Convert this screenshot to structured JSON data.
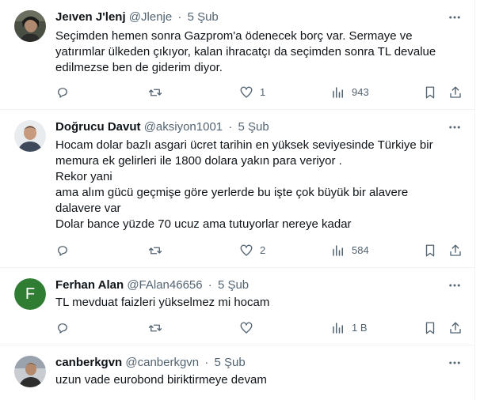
{
  "tweets": [
    {
      "name": "Jeıven J'lenj",
      "handle": "@Jlenje",
      "sep": "·",
      "time": "5 Şub",
      "lines": [
        "Seçimden hemen sonra Gazprom'a ödenecek borç var.  Sermaye ve",
        "yatırımlar ülkeden çıkıyor, kalan ihracatçı da seçimden sonra TL devalue",
        "edilmezse ben de giderim diyor."
      ],
      "likes": "1",
      "views": "943"
    },
    {
      "name": "Doğrucu Davut",
      "handle": "@aksiyon1001",
      "sep": "·",
      "time": "5 Şub",
      "lines": [
        "Hocam dolar bazlı asgari ücret tarihin en yüksek seviyesinde Türkiye bir",
        "memura ek gelirleri ile 1800 dolara yakın para veriyor .",
        "Rekor yani",
        "ama alım gücü geçmişe göre  yerlerde bu işte çok büyük bir alavere",
        "dalavere var",
        "Dolar bance yüzde 70 ucuz ama tutuyorlar nereye kadar"
      ],
      "likes": "2",
      "views": "584"
    },
    {
      "name": "Ferhan Alan",
      "handle": "@FAlan46656",
      "sep": "·",
      "time": "5 Şub",
      "avatar_letter": "F",
      "lines": [
        "TL mevduat faizleri yükselmez mi hocam"
      ],
      "likes": "",
      "views": "1 B"
    },
    {
      "name": "canberkgvn",
      "handle": "@canberkgvn",
      "sep": "·",
      "time": "5 Şub",
      "lines": [
        "uzun vade eurobond biriktirmeye devam"
      ]
    }
  ],
  "colors": {
    "text": "#0f1419",
    "muted": "#536471",
    "divider": "#eff3f4",
    "avatar_f": "#2e7d32"
  },
  "icons": [
    "more-icon",
    "reply-icon",
    "retweet-icon",
    "like-icon",
    "views-icon",
    "bookmark-icon",
    "share-icon"
  ]
}
